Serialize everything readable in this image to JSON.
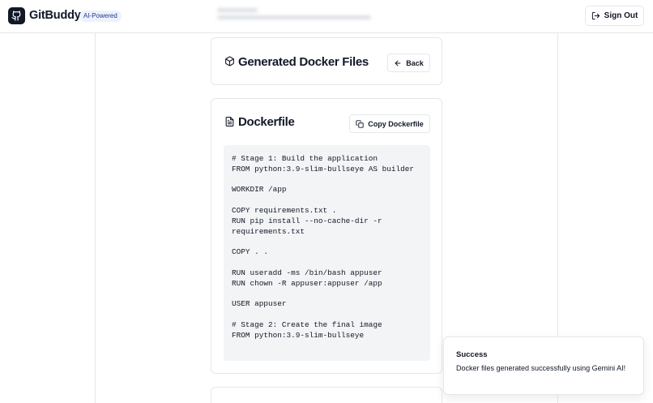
{
  "header": {
    "brand": "GitBuddy",
    "badge": "AI-Powered",
    "sign_out_label": "Sign Out",
    "logo_icon": "github-icon",
    "sign_out_icon": "log-out-icon"
  },
  "generated_card": {
    "title": "Generated Docker Files",
    "icon": "package-icon",
    "back_label": "Back",
    "back_icon": "arrow-left-icon"
  },
  "dockerfile_card": {
    "title": "Dockerfile",
    "icon": "file-text-icon",
    "copy_label": "Copy Dockerfile",
    "copy_icon": "copy-icon",
    "code_lines": [
      "# Stage 1: Build the application",
      "FROM python:3.9-slim-bullseye AS builder",
      "",
      "WORKDIR /app",
      "",
      "COPY requirements.txt .",
      "RUN pip install --no-cache-dir -r",
      "requirements.txt",
      "",
      "COPY . .",
      "",
      "RUN useradd -ms /bin/bash appuser",
      "RUN chown -R appuser:appuser /app",
      "",
      "USER appuser",
      "",
      "# Stage 2: Create the final image",
      "FROM python:3.9-slim-bullseye"
    ]
  },
  "toast": {
    "title": "Success",
    "message": "Docker files generated successfully using Gemini AI!"
  },
  "colors": {
    "text": "#111827",
    "border": "#e5e7eb",
    "code_bg": "#f3f4f6",
    "badge_bg": "#eef2ff",
    "badge_text": "#1e3a8a"
  }
}
